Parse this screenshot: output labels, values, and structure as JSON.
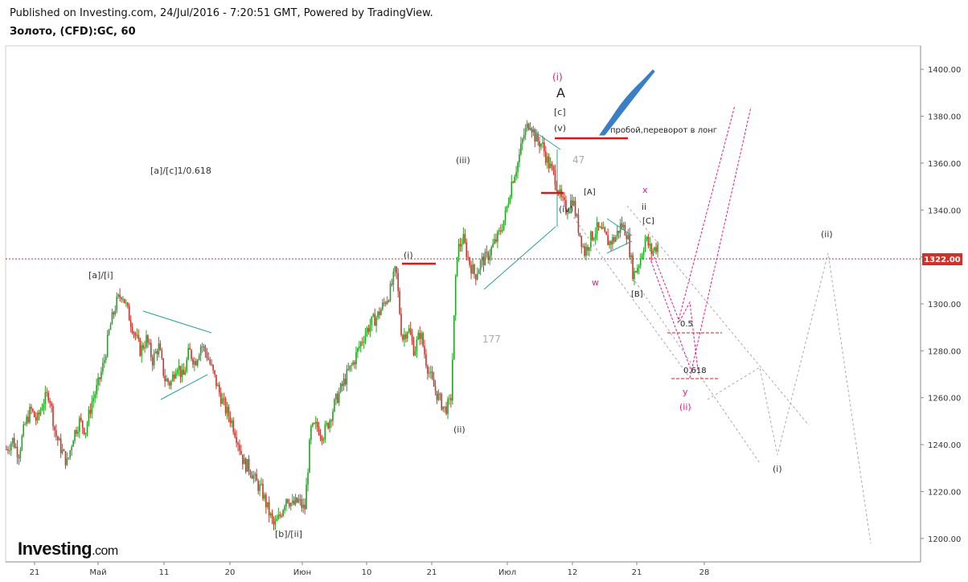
{
  "header": {
    "published": "Published on Investing.com, 24/Jul/2016 - 7:20:51 GMT, Powered by TradingView.",
    "symbol": "Золото, (CFD):GC, 60"
  },
  "logo": {
    "main": "Investing",
    "suffix": ".com"
  },
  "colors": {
    "up": "#1fa51f",
    "down": "#d0322a",
    "accent": "#e8188c",
    "teal": "#2aa198",
    "red": "#e31414",
    "blue": "#3a7fc6",
    "grey": "#999999"
  },
  "chart_data": {
    "type": "line",
    "title": "",
    "ylim": [
      1190,
      1410
    ],
    "y_ticks": [
      "1400.00",
      "1380.00",
      "1360.00",
      "1340.00",
      "1320.00",
      "1300.00",
      "1280.00",
      "1260.00",
      "1240.00",
      "1220.00",
      "1200.00"
    ],
    "x_ticks": [
      "21",
      "Май",
      "11",
      "20",
      "Июн",
      "10",
      "21",
      "Июл",
      "12",
      "21",
      "28"
    ],
    "current_price": "1322.00",
    "series": [
      {
        "values": [
          1238,
          1242,
          1236,
          1248,
          1255,
          1250,
          1258,
          1262,
          1245,
          1238,
          1232,
          1244,
          1250,
          1246,
          1258,
          1265,
          1275,
          1290,
          1300,
          1305,
          1296,
          1288,
          1280,
          1285,
          1276,
          1282,
          1268,
          1266,
          1275,
          1268,
          1280,
          1275,
          1283,
          1278,
          1270,
          1262,
          1255,
          1250,
          1242,
          1232,
          1230,
          1224,
          1220,
          1212,
          1205,
          1210,
          1218,
          1214,
          1216,
          1212,
          1246,
          1248,
          1244,
          1250,
          1258,
          1264,
          1270,
          1275,
          1282,
          1288,
          1292,
          1295,
          1300,
          1305,
          1315,
          1285,
          1290,
          1280,
          1288,
          1275,
          1266,
          1260,
          1255,
          1258,
          1322,
          1328,
          1318,
          1312,
          1318,
          1320,
          1325,
          1330,
          1338,
          1352,
          1360,
          1372,
          1378,
          1370,
          1368,
          1360,
          1355,
          1345,
          1340,
          1345,
          1332,
          1322,
          1328,
          1332,
          1330,
          1326,
          1328,
          1334,
          1330,
          1312,
          1318,
          1328,
          1322,
          1325
        ]
      }
    ],
    "annotations": {
      "a_i": "[a]/[i]",
      "ac": "[a]/[c]1/0.618",
      "b_ii": "[b]/[ii]",
      "i_left": "(i)",
      "iii": "(iii)",
      "ii_low": "(ii)",
      "iv": "(iv)",
      "v": "(v)",
      "c": "[c]",
      "A": "A",
      "i_pink": "(i)",
      "n47": "47",
      "n177": "177",
      "A_sq": "[A]",
      "B_sq": "[B]",
      "C_sq": "[C]",
      "w": "w",
      "x": "x",
      "y": "y",
      "ii_small": "ii",
      "ii_pink": "(ii)",
      "fib05": "0.5",
      "fib0618": "0.618",
      "i_right": "(i)",
      "ii_right": "(ii)",
      "breakout": "пробой,переворот в лонг"
    }
  }
}
